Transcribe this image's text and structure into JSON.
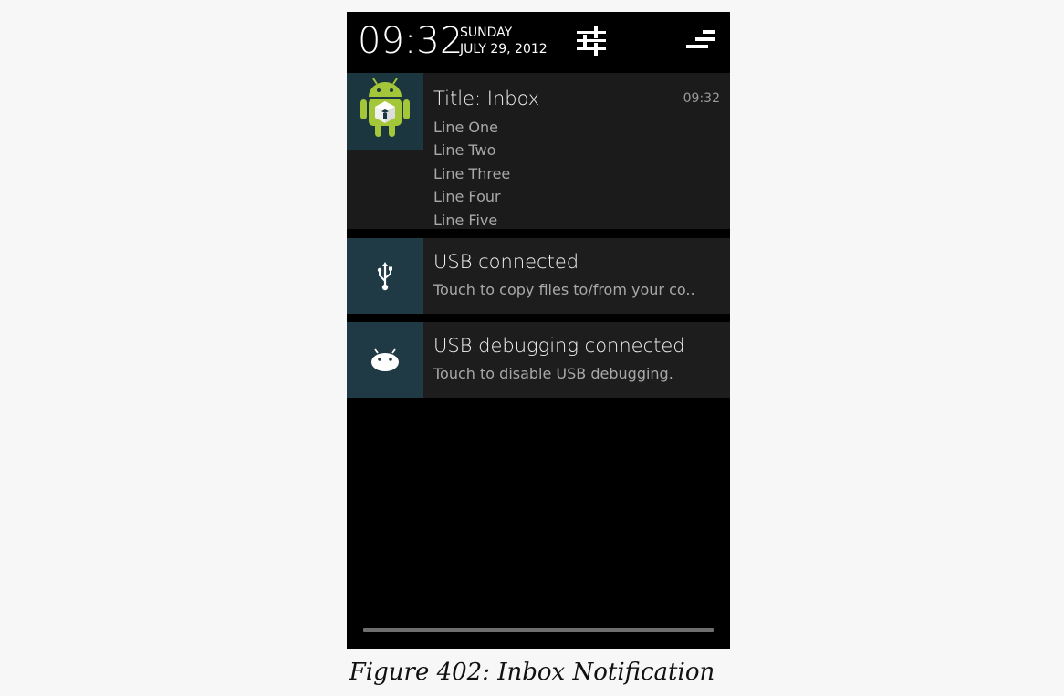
{
  "status_header": {
    "time": "09:32",
    "day": "SUNDAY",
    "date": "JULY 29, 2012",
    "settings_icon": "settings-sliders-icon",
    "clear_icon": "clear-notifications-icon"
  },
  "notifications": [
    {
      "icon": "android-box-icon",
      "title": "Title: Inbox",
      "time": "09:32",
      "lines": [
        "Line One",
        "Line Two",
        "Line Three",
        "Line Four",
        "Line Five"
      ]
    },
    {
      "icon": "usb-icon",
      "title": "USB connected",
      "text": "Touch to copy files to/from your co.."
    },
    {
      "icon": "android-debug-icon",
      "title": "USB debugging connected",
      "text": "Touch to disable USB debugging."
    }
  ],
  "caption": "Figure 402: Inbox Notification",
  "colors": {
    "page_background": "#f7f7f7",
    "shade_background": "#000000",
    "notification_background": "#1d1d1d",
    "icon_background": "#1f3a45",
    "android_green": "#a4c639"
  }
}
